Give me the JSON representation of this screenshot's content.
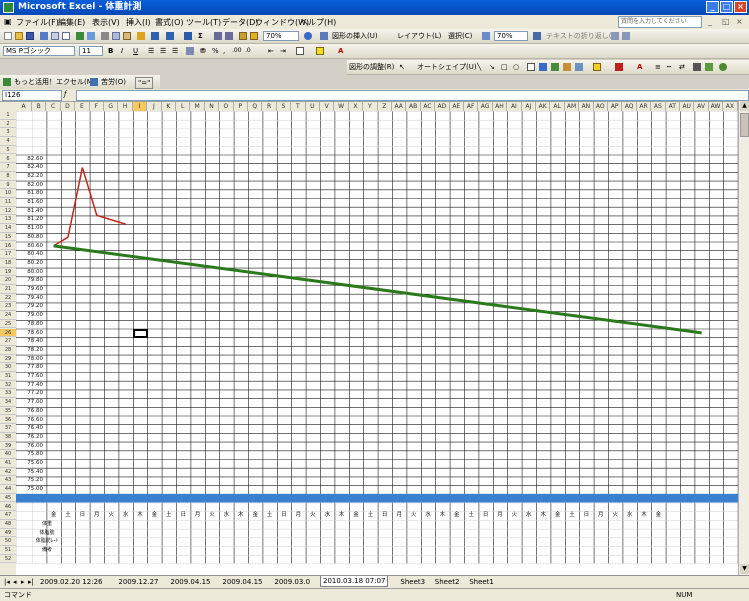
{
  "window": {
    "title": "Microsoft Excel - 体重計測"
  },
  "menu": {
    "items": [
      "ファイル(F)",
      "編集(E)",
      "表示(V)",
      "挿入(I)",
      "書式(O)",
      "ツール(T)",
      "データ(D)",
      "ウィンドウ(W)",
      "ヘルプ(H)"
    ],
    "help_placeholder": "質問を入力してください"
  },
  "toolbar1": {
    "zoom": "70%",
    "insert_shape": "図形の挿入(U)",
    "layout": "レイアウト(L)",
    "select": "選択(C)",
    "zoom2": "70%",
    "text_wrap": "テキストの折り返し(X)"
  },
  "toolbar2": {
    "font_name": "MS Pゴシック",
    "font_size": "11"
  },
  "toolbar3": {
    "draw": "図形の調整(R)",
    "autoshape": "オートシェイプ(U)"
  },
  "toolbar4": {
    "more_help": "もっと活用！エクセル(M)",
    "entry": "苦労(O)"
  },
  "namebox": {
    "cell": "I126"
  },
  "columns": [
    "A",
    "B",
    "C",
    "D",
    "E",
    "F",
    "G",
    "H",
    "I",
    "J",
    "K",
    "L",
    "M",
    "N",
    "O",
    "P",
    "Q",
    "R",
    "S",
    "T",
    "U",
    "V",
    "W",
    "X",
    "Y",
    "Z",
    "AA",
    "AB",
    "AC",
    "AD",
    "AE",
    "AF",
    "AG",
    "AH",
    "AI",
    "AJ",
    "AK",
    "AL",
    "AM",
    "AN",
    "AO",
    "AP",
    "AQ",
    "AR",
    "AS",
    "AT",
    "AU",
    "AV",
    "AW",
    "AX"
  ],
  "rows": [
    "1",
    "2",
    "3",
    "4",
    "5",
    "6",
    "7",
    "8",
    "9",
    "10",
    "11",
    "12",
    "13",
    "14",
    "15",
    "16",
    "17",
    "18",
    "19",
    "20",
    "21",
    "22",
    "23",
    "24",
    "25",
    "26",
    "27",
    "28",
    "29",
    "30",
    "31",
    "32",
    "33",
    "34",
    "35",
    "36",
    "37",
    "38",
    "39",
    "40",
    "41",
    "42",
    "43",
    "44",
    "45",
    "46",
    "47",
    "48",
    "49",
    "50",
    "51",
    "52"
  ],
  "weights": [
    "82.60",
    "82.40",
    "82.20",
    "82.00",
    "81.80",
    "81.60",
    "81.40",
    "81.20",
    "81.00",
    "80.80",
    "80.60",
    "80.40",
    "80.20",
    "80.00",
    "79.80",
    "79.60",
    "79.40",
    "79.20",
    "79.00",
    "78.80",
    "78.60",
    "78.40",
    "78.20",
    "78.00",
    "77.80",
    "77.60",
    "77.40",
    "77.20",
    "77.00",
    "76.80",
    "76.60",
    "76.40",
    "76.20",
    "76.00",
    "75.80",
    "75.60",
    "75.40",
    "75.20",
    "75.00"
  ],
  "calendar": {
    "weekdays": [
      "金",
      "土",
      "日",
      "月",
      "火",
      "水",
      "木",
      "金",
      "土",
      "日",
      "月",
      "火",
      "水",
      "木",
      "金",
      "土",
      "日",
      "月",
      "火",
      "水",
      "木",
      "金",
      "土",
      "日",
      "月",
      "火",
      "水",
      "木",
      "金",
      "土",
      "日",
      "月",
      "火",
      "水",
      "木",
      "金",
      "土",
      "日",
      "月",
      "火",
      "水",
      "木",
      "金"
    ],
    "row_labels": [
      "体重",
      "体脂肪",
      "体脂肪ﾚｰﾄ",
      "備考"
    ]
  },
  "tabs": [
    "2009.02.20 12:26",
    "2009.12.27",
    "2009.04.15",
    "2009.04.15",
    "2009.03.0",
    "2010.03.18 07:07",
    "Sheet3",
    "Sheet2",
    "Sheet1"
  ],
  "active_tab_index": 5,
  "status": {
    "mode": "コマンド",
    "num": "NUM"
  },
  "chart_data": {
    "type": "line",
    "series": [
      {
        "color": "#c0281c",
        "x": [
          1,
          2,
          3,
          4,
          5,
          6
        ],
        "y": [
          80.6,
          80.8,
          82.4,
          81.3,
          81.2,
          81.1
        ]
      },
      {
        "color": "#2a7a1c",
        "x": [
          1,
          46
        ],
        "y": [
          80.6,
          78.6
        ]
      }
    ],
    "ylim": [
      75.0,
      82.6
    ]
  }
}
